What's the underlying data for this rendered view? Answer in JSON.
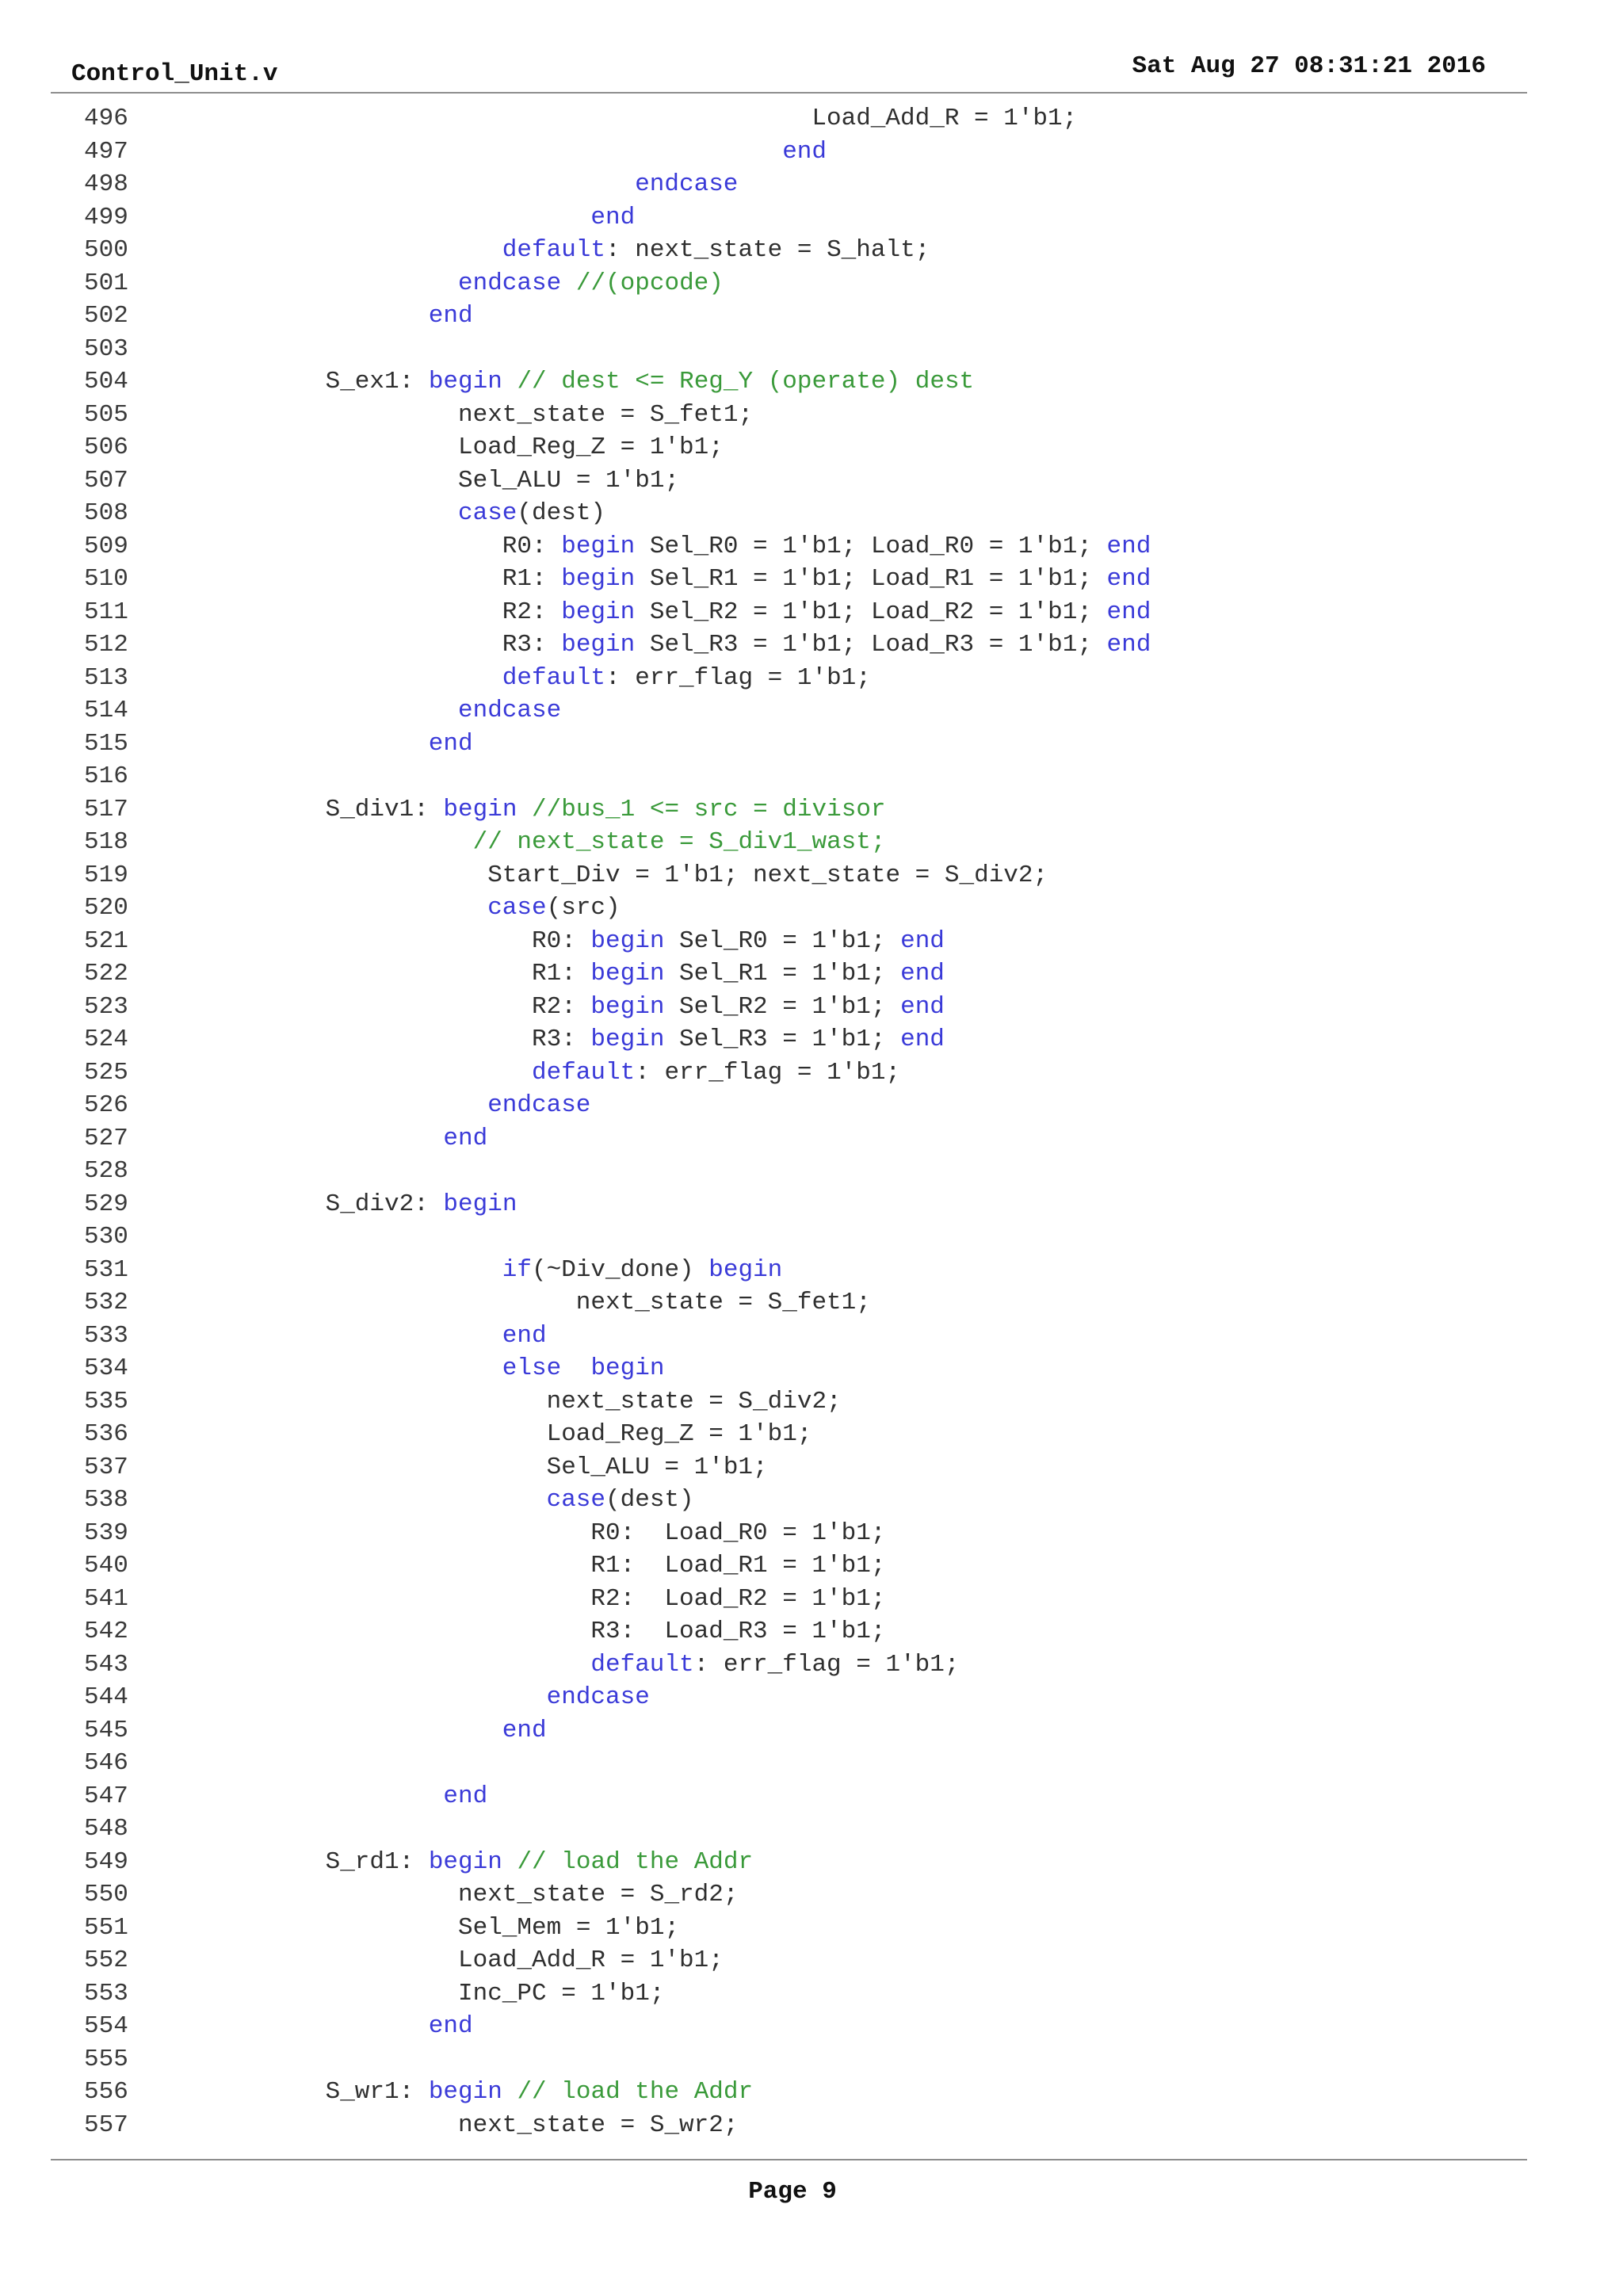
{
  "header": {
    "file_name": "Control_Unit.v",
    "date": "Sat Aug 27 08:31:21 2016"
  },
  "colors": {
    "keyword": "#3a3ad8",
    "comment": "#3a9a3a",
    "text": "#2f2f2f"
  },
  "lines": [
    {
      "n": "496",
      "indent": 44,
      "segs": [
        [
          "t",
          "Load_Add_R = 1'b1;"
        ]
      ]
    },
    {
      "n": "497",
      "indent": 42,
      "segs": [
        [
          "k",
          "end"
        ]
      ]
    },
    {
      "n": "498",
      "indent": 32,
      "segs": [
        [
          "k",
          "endcase"
        ]
      ]
    },
    {
      "n": "499",
      "indent": 29,
      "segs": [
        [
          "k",
          "end"
        ]
      ]
    },
    {
      "n": "500",
      "indent": 23,
      "segs": [
        [
          "k",
          "default"
        ],
        [
          "t",
          ": next_state = S_halt;"
        ]
      ]
    },
    {
      "n": "501",
      "indent": 20,
      "segs": [
        [
          "k",
          "endcase"
        ],
        [
          "t",
          " "
        ],
        [
          "c",
          "//(opcode)"
        ]
      ]
    },
    {
      "n": "502",
      "indent": 18,
      "segs": [
        [
          "k",
          "end"
        ]
      ]
    },
    {
      "n": "503",
      "indent": 0,
      "segs": []
    },
    {
      "n": "504",
      "indent": 11,
      "segs": [
        [
          "t",
          "S_ex1: "
        ],
        [
          "k",
          "begin"
        ],
        [
          "t",
          " "
        ],
        [
          "c",
          "// dest <= Reg_Y (operate) dest"
        ]
      ]
    },
    {
      "n": "505",
      "indent": 20,
      "segs": [
        [
          "t",
          "next_state = S_fet1;"
        ]
      ]
    },
    {
      "n": "506",
      "indent": 20,
      "segs": [
        [
          "t",
          "Load_Reg_Z = 1'b1;"
        ]
      ]
    },
    {
      "n": "507",
      "indent": 20,
      "segs": [
        [
          "t",
          "Sel_ALU = 1'b1;"
        ]
      ]
    },
    {
      "n": "508",
      "indent": 20,
      "segs": [
        [
          "k",
          "case"
        ],
        [
          "t",
          "(dest)"
        ]
      ]
    },
    {
      "n": "509",
      "indent": 23,
      "segs": [
        [
          "t",
          "R0: "
        ],
        [
          "k",
          "begin"
        ],
        [
          "t",
          " Sel_R0 = 1'b1; Load_R0 = 1'b1; "
        ],
        [
          "k",
          "end"
        ]
      ]
    },
    {
      "n": "510",
      "indent": 23,
      "segs": [
        [
          "t",
          "R1: "
        ],
        [
          "k",
          "begin"
        ],
        [
          "t",
          " Sel_R1 = 1'b1; Load_R1 = 1'b1; "
        ],
        [
          "k",
          "end"
        ]
      ]
    },
    {
      "n": "511",
      "indent": 23,
      "segs": [
        [
          "t",
          "R2: "
        ],
        [
          "k",
          "begin"
        ],
        [
          "t",
          " Sel_R2 = 1'b1; Load_R2 = 1'b1; "
        ],
        [
          "k",
          "end"
        ]
      ]
    },
    {
      "n": "512",
      "indent": 23,
      "segs": [
        [
          "t",
          "R3: "
        ],
        [
          "k",
          "begin"
        ],
        [
          "t",
          " Sel_R3 = 1'b1; Load_R3 = 1'b1; "
        ],
        [
          "k",
          "end"
        ]
      ]
    },
    {
      "n": "513",
      "indent": 23,
      "segs": [
        [
          "k",
          "default"
        ],
        [
          "t",
          ": err_flag = 1'b1;"
        ]
      ]
    },
    {
      "n": "514",
      "indent": 20,
      "segs": [
        [
          "k",
          "endcase"
        ]
      ]
    },
    {
      "n": "515",
      "indent": 18,
      "segs": [
        [
          "k",
          "end"
        ]
      ]
    },
    {
      "n": "516",
      "indent": 0,
      "segs": []
    },
    {
      "n": "517",
      "indent": 11,
      "segs": [
        [
          "t",
          "S_div1: "
        ],
        [
          "k",
          "begin"
        ],
        [
          "t",
          " "
        ],
        [
          "c",
          "//bus_1 <= src = divisor"
        ]
      ]
    },
    {
      "n": "518",
      "indent": 21,
      "segs": [
        [
          "c",
          "// next_state = S_div1_wast;"
        ]
      ]
    },
    {
      "n": "519",
      "indent": 22,
      "segs": [
        [
          "t",
          "Start_Div = 1'b1; next_state = S_div2;"
        ]
      ]
    },
    {
      "n": "520",
      "indent": 22,
      "segs": [
        [
          "k",
          "case"
        ],
        [
          "t",
          "(src)"
        ]
      ]
    },
    {
      "n": "521",
      "indent": 25,
      "segs": [
        [
          "t",
          "R0: "
        ],
        [
          "k",
          "begin"
        ],
        [
          "t",
          " Sel_R0 = 1'b1; "
        ],
        [
          "k",
          "end"
        ]
      ]
    },
    {
      "n": "522",
      "indent": 25,
      "segs": [
        [
          "t",
          "R1: "
        ],
        [
          "k",
          "begin"
        ],
        [
          "t",
          " Sel_R1 = 1'b1; "
        ],
        [
          "k",
          "end"
        ]
      ]
    },
    {
      "n": "523",
      "indent": 25,
      "segs": [
        [
          "t",
          "R2: "
        ],
        [
          "k",
          "begin"
        ],
        [
          "t",
          " Sel_R2 = 1'b1; "
        ],
        [
          "k",
          "end"
        ]
      ]
    },
    {
      "n": "524",
      "indent": 25,
      "segs": [
        [
          "t",
          "R3: "
        ],
        [
          "k",
          "begin"
        ],
        [
          "t",
          " Sel_R3 = 1'b1; "
        ],
        [
          "k",
          "end"
        ]
      ]
    },
    {
      "n": "525",
      "indent": 25,
      "segs": [
        [
          "k",
          "default"
        ],
        [
          "t",
          ": err_flag = 1'b1;"
        ]
      ]
    },
    {
      "n": "526",
      "indent": 22,
      "segs": [
        [
          "k",
          "endcase"
        ]
      ]
    },
    {
      "n": "527",
      "indent": 19,
      "segs": [
        [
          "k",
          "end"
        ]
      ]
    },
    {
      "n": "528",
      "indent": 0,
      "segs": []
    },
    {
      "n": "529",
      "indent": 11,
      "segs": [
        [
          "t",
          "S_div2: "
        ],
        [
          "k",
          "begin"
        ]
      ]
    },
    {
      "n": "530",
      "indent": 0,
      "segs": []
    },
    {
      "n": "531",
      "indent": 23,
      "segs": [
        [
          "k",
          "if"
        ],
        [
          "t",
          "(~Div_done) "
        ],
        [
          "k",
          "begin"
        ]
      ]
    },
    {
      "n": "532",
      "indent": 28,
      "segs": [
        [
          "t",
          "next_state = S_fet1;"
        ]
      ]
    },
    {
      "n": "533",
      "indent": 23,
      "segs": [
        [
          "k",
          "end"
        ]
      ]
    },
    {
      "n": "534",
      "indent": 23,
      "segs": [
        [
          "k",
          "else"
        ],
        [
          "t",
          "  "
        ],
        [
          "k",
          "begin"
        ]
      ]
    },
    {
      "n": "535",
      "indent": 26,
      "segs": [
        [
          "t",
          "next_state = S_div2;"
        ]
      ]
    },
    {
      "n": "536",
      "indent": 26,
      "segs": [
        [
          "t",
          "Load_Reg_Z = 1'b1;"
        ]
      ]
    },
    {
      "n": "537",
      "indent": 26,
      "segs": [
        [
          "t",
          "Sel_ALU = 1'b1;"
        ]
      ]
    },
    {
      "n": "538",
      "indent": 26,
      "segs": [
        [
          "k",
          "case"
        ],
        [
          "t",
          "(dest)"
        ]
      ]
    },
    {
      "n": "539",
      "indent": 29,
      "segs": [
        [
          "t",
          "R0:  Load_R0 = 1'b1;"
        ]
      ]
    },
    {
      "n": "540",
      "indent": 29,
      "segs": [
        [
          "t",
          "R1:  Load_R1 = 1'b1;"
        ]
      ]
    },
    {
      "n": "541",
      "indent": 29,
      "segs": [
        [
          "t",
          "R2:  Load_R2 = 1'b1;"
        ]
      ]
    },
    {
      "n": "542",
      "indent": 29,
      "segs": [
        [
          "t",
          "R3:  Load_R3 = 1'b1;"
        ]
      ]
    },
    {
      "n": "543",
      "indent": 29,
      "segs": [
        [
          "k",
          "default"
        ],
        [
          "t",
          ": err_flag = 1'b1;"
        ]
      ]
    },
    {
      "n": "544",
      "indent": 26,
      "segs": [
        [
          "k",
          "endcase"
        ]
      ]
    },
    {
      "n": "545",
      "indent": 23,
      "segs": [
        [
          "k",
          "end"
        ]
      ]
    },
    {
      "n": "546",
      "indent": 0,
      "segs": []
    },
    {
      "n": "547",
      "indent": 19,
      "segs": [
        [
          "k",
          "end"
        ]
      ]
    },
    {
      "n": "548",
      "indent": 0,
      "segs": []
    },
    {
      "n": "549",
      "indent": 11,
      "segs": [
        [
          "t",
          "S_rd1: "
        ],
        [
          "k",
          "begin"
        ],
        [
          "t",
          " "
        ],
        [
          "c",
          "// load the Addr"
        ]
      ]
    },
    {
      "n": "550",
      "indent": 20,
      "segs": [
        [
          "t",
          "next_state = S_rd2;"
        ]
      ]
    },
    {
      "n": "551",
      "indent": 20,
      "segs": [
        [
          "t",
          "Sel_Mem = 1'b1;"
        ]
      ]
    },
    {
      "n": "552",
      "indent": 20,
      "segs": [
        [
          "t",
          "Load_Add_R = 1'b1;"
        ]
      ]
    },
    {
      "n": "553",
      "indent": 20,
      "segs": [
        [
          "t",
          "Inc_PC = 1'b1;"
        ]
      ]
    },
    {
      "n": "554",
      "indent": 18,
      "segs": [
        [
          "k",
          "end"
        ]
      ]
    },
    {
      "n": "555",
      "indent": 0,
      "segs": []
    },
    {
      "n": "556",
      "indent": 11,
      "segs": [
        [
          "t",
          "S_wr1: "
        ],
        [
          "k",
          "begin"
        ],
        [
          "t",
          " "
        ],
        [
          "c",
          "// load the Addr"
        ]
      ]
    },
    {
      "n": "557",
      "indent": 20,
      "segs": [
        [
          "t",
          "next_state = S_wr2;"
        ]
      ]
    }
  ],
  "footer": {
    "page_label": "Page 9"
  }
}
